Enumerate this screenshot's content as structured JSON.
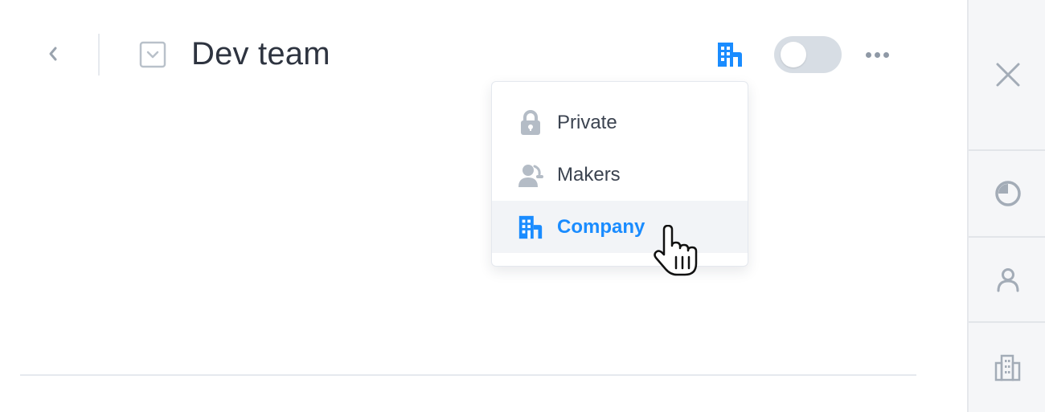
{
  "header": {
    "title": "Dev team",
    "back_icon": "chevron-left-icon",
    "checkbox_icon": "checkbox-chevron-icon",
    "visibility_icon": "building-icon",
    "more_icon": "ellipsis-icon"
  },
  "toggle": {
    "state": "off"
  },
  "visibility_menu": {
    "items": [
      {
        "label": "Private",
        "icon": "lock-icon"
      },
      {
        "label": "Makers",
        "icon": "makers-icon"
      },
      {
        "label": "Company",
        "icon": "building-icon",
        "selected": true
      }
    ]
  },
  "right_panel": {
    "items": [
      {
        "icon": "close-icon"
      },
      {
        "icon": "pie-chart-icon"
      },
      {
        "icon": "user-icon"
      },
      {
        "icon": "building-icon"
      }
    ]
  },
  "colors": {
    "accent": "#1a8cff",
    "icon_gray": "#b4bcc6",
    "text": "#2e3440",
    "toggle_off": "#d7dde4",
    "highlight": "#f2f4f7"
  }
}
